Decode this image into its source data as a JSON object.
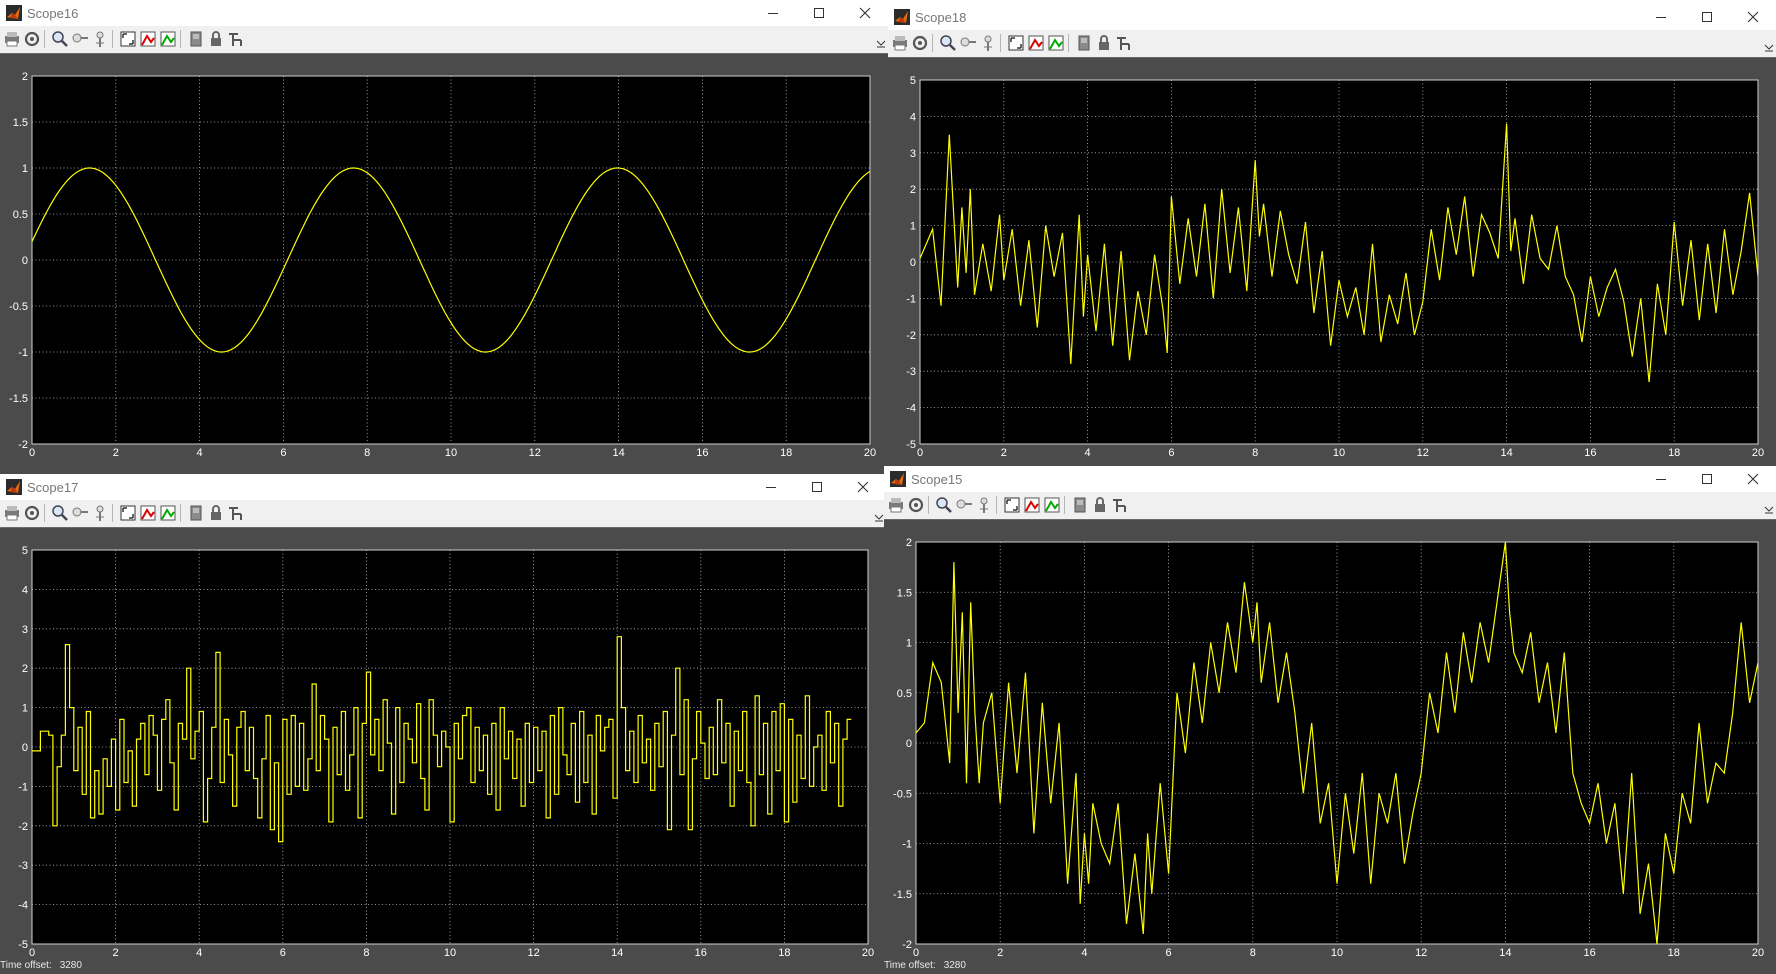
{
  "colors": {
    "background": "#000000",
    "trace": "#ffff00",
    "grid": "#bdbdbd",
    "frame": "#4b4b4b",
    "label": "#ffffff"
  },
  "toolbar_icons": [
    "print-icon",
    "parameters-icon",
    "zoom-icon",
    "zoom-x-icon",
    "zoom-y-icon",
    "autoscale-icon",
    "save-axes-settings-icon",
    "restore-axes-settings-icon",
    "floating-scope-icon",
    "lock-axes-icon",
    "signal-selection-icon"
  ],
  "scopes": [
    {
      "title": "Scope16",
      "time_offset_label": "",
      "time_offset_value": "",
      "chart_data": {
        "type": "line",
        "xlim": [
          0,
          20
        ],
        "ylim": [
          -2,
          2
        ],
        "xticks": [
          0,
          2,
          4,
          6,
          8,
          10,
          12,
          14,
          16,
          18,
          20
        ],
        "yticks": [
          -2,
          -1.5,
          -1,
          -0.5,
          0,
          0.5,
          1,
          1.5,
          2
        ],
        "grid": true,
        "series": [
          {
            "sine": {
              "amplitude": 1,
              "period": 6.3,
              "phase_at_zero": 0.2
            }
          }
        ]
      }
    },
    {
      "title": "Scope18",
      "time_offset_label": "",
      "time_offset_value": "",
      "chart_data": {
        "type": "line",
        "xlim": [
          0,
          20
        ],
        "ylim": [
          -5,
          5
        ],
        "xticks": [
          0,
          2,
          4,
          6,
          8,
          10,
          12,
          14,
          16,
          18,
          20
        ],
        "yticks": [
          -5,
          -4,
          -3,
          -2,
          -1,
          0,
          1,
          2,
          3,
          4,
          5
        ],
        "grid": true,
        "series": [
          {
            "x": [
              0,
              0.3,
              0.5,
              0.7,
              0.9,
              1.0,
              1.1,
              1.2,
              1.3,
              1.5,
              1.7,
              1.9,
              2.0,
              2.2,
              2.4,
              2.6,
              2.8,
              3.0,
              3.2,
              3.4,
              3.6,
              3.8,
              3.9,
              4.0,
              4.2,
              4.4,
              4.6,
              4.8,
              5.0,
              5.2,
              5.4,
              5.6,
              5.8,
              5.9,
              6.0,
              6.2,
              6.4,
              6.6,
              6.8,
              7.0,
              7.2,
              7.4,
              7.6,
              7.8,
              8.0,
              8.1,
              8.2,
              8.4,
              8.6,
              8.8,
              9.0,
              9.2,
              9.4,
              9.6,
              9.8,
              10.0,
              10.2,
              10.4,
              10.6,
              10.8,
              11.0,
              11.2,
              11.4,
              11.6,
              11.8,
              12.0,
              12.2,
              12.4,
              12.6,
              12.8,
              13.0,
              13.2,
              13.4,
              13.6,
              13.8,
              14.0,
              14.1,
              14.2,
              14.4,
              14.6,
              14.8,
              15.0,
              15.2,
              15.4,
              15.6,
              15.8,
              16.0,
              16.2,
              16.4,
              16.6,
              16.8,
              17.0,
              17.2,
              17.4,
              17.6,
              17.8,
              18.0,
              18.2,
              18.4,
              18.6,
              18.8,
              19.0,
              19.2,
              19.4,
              19.6,
              19.8,
              20.0
            ],
            "y": [
              0.1,
              0.9,
              -1.2,
              3.5,
              -0.7,
              1.5,
              -0.3,
              2.0,
              -0.9,
              0.5,
              -0.8,
              1.3,
              -0.5,
              0.9,
              -1.2,
              0.6,
              -1.8,
              1.0,
              -0.4,
              0.8,
              -2.8,
              1.3,
              -1.5,
              0.2,
              -1.9,
              0.5,
              -2.3,
              0.3,
              -2.7,
              -0.8,
              -2.0,
              0.2,
              -1.3,
              -2.5,
              1.8,
              -0.6,
              1.2,
              -0.4,
              1.6,
              -1.0,
              2.0,
              -0.3,
              1.5,
              -0.8,
              2.8,
              0.7,
              1.6,
              -0.4,
              1.4,
              0.2,
              -0.6,
              1.1,
              -1.4,
              0.3,
              -2.3,
              -0.5,
              -1.5,
              -0.7,
              -2.0,
              0.5,
              -2.2,
              -0.9,
              -1.7,
              -0.3,
              -2.0,
              -1.1,
              0.9,
              -0.5,
              1.5,
              0.2,
              1.8,
              -0.4,
              1.3,
              0.8,
              0.1,
              3.8,
              0.3,
              1.2,
              -0.6,
              1.3,
              0.1,
              -0.2,
              1.0,
              -0.4,
              -0.9,
              -2.2,
              -0.4,
              -1.5,
              -0.7,
              -0.2,
              -1.1,
              -2.6,
              -1.0,
              -3.3,
              -0.6,
              -2.0,
              1.1,
              -1.2,
              0.6,
              -1.6,
              0.5,
              -1.4,
              0.9,
              -0.9,
              0.3,
              1.9,
              -0.4,
              1.5
            ]
          }
        ]
      }
    },
    {
      "title": "Scope17",
      "time_offset_label": "Time offset:",
      "time_offset_value": "3280",
      "chart_data": {
        "type": "line",
        "step": true,
        "xlim": [
          0,
          20
        ],
        "ylim": [
          -5,
          5
        ],
        "xticks": [
          0,
          2,
          4,
          6,
          8,
          10,
          12,
          14,
          16,
          18,
          20
        ],
        "yticks": [
          -5,
          -4,
          -3,
          -2,
          -1,
          0,
          1,
          2,
          3,
          4,
          5
        ],
        "grid": true,
        "series": [
          {
            "x0": 0,
            "dx": 0.1,
            "y": [
              -0.1,
              -0.1,
              0.4,
              0.4,
              0.3,
              -2.0,
              -0.5,
              0.3,
              2.6,
              1.0,
              -0.6,
              0.5,
              -1.2,
              0.9,
              -1.8,
              -0.6,
              -1.7,
              -0.3,
              -1.0,
              0.2,
              -1.6,
              0.7,
              -0.9,
              -0.1,
              -1.5,
              0.2,
              0.6,
              -0.7,
              0.8,
              0.3,
              -1.1,
              0.7,
              1.2,
              -0.4,
              -1.6,
              0.6,
              0.2,
              2.0,
              -0.3,
              0.4,
              0.9,
              -1.9,
              -0.8,
              0.5,
              2.4,
              -0.9,
              0.7,
              -0.2,
              -1.5,
              0.5,
              0.9,
              -0.6,
              0.5,
              -0.8,
              -1.8,
              -0.3,
              0.8,
              -2.1,
              -0.4,
              -2.4,
              0.7,
              -1.2,
              0.8,
              -1.0,
              0.6,
              -1.1,
              -0.3,
              1.6,
              -0.6,
              0.8,
              0.2,
              -1.9,
              0.5,
              -0.7,
              0.9,
              -1.1,
              -0.2,
              1.0,
              -1.8,
              0.6,
              1.9,
              -0.2,
              0.7,
              -0.6,
              1.2,
              0.1,
              -1.7,
              1.0,
              -0.9,
              0.6,
              0.2,
              -0.4,
              1.1,
              -0.8,
              -1.6,
              1.2,
              0.3,
              -0.5,
              0.4,
              0.0,
              -1.9,
              0.6,
              -0.3,
              0.8,
              1.0,
              -0.9,
              0.5,
              -0.6,
              0.3,
              -1.2,
              0.6,
              -1.6,
              1.0,
              -0.3,
              0.4,
              -0.8,
              0.2,
              -1.5,
              0.6,
              -0.9,
              0.5,
              -0.6,
              0.4,
              -1.8,
              0.8,
              -1.2,
              1.0,
              -0.2,
              -0.7,
              0.6,
              -1.4,
              0.9,
              -0.9,
              0.3,
              -1.7,
              0.8,
              -0.1,
              0.5,
              0.7,
              -1.3,
              2.8,
              1.0,
              -0.6,
              0.4,
              -0.9,
              0.8,
              -0.4,
              0.2,
              -1.1,
              0.6,
              -0.5,
              0.9,
              -2.1,
              0.3,
              2.0,
              -0.7,
              1.2,
              -2.1,
              -0.3,
              0.9,
              0.1,
              -0.8,
              0.5,
              -0.7,
              1.2,
              -0.4,
              0.6,
              -1.5,
              0.4,
              -0.6,
              0.9,
              -0.9,
              -2.0,
              1.3,
              -0.7,
              0.6,
              -1.7,
              0.9,
              -0.6,
              1.1,
              -1.9,
              0.7,
              -1.4,
              0.3,
              -0.8,
              1.3,
              -1.0,
              0.0,
              0.3,
              -1.1,
              0.9,
              -0.4,
              0.6,
              -1.5,
              0.2,
              0.7
            ]
          }
        ]
      }
    },
    {
      "title": "Scope15",
      "time_offset_label": "Time offset:",
      "time_offset_value": "3280",
      "chart_data": {
        "type": "line",
        "xlim": [
          0,
          20
        ],
        "ylim": [
          -2,
          2
        ],
        "xticks": [
          0,
          2,
          4,
          6,
          8,
          10,
          12,
          14,
          16,
          18,
          20
        ],
        "yticks": [
          -2,
          -1.5,
          -1,
          -0.5,
          0,
          0.5,
          1,
          1.5,
          2
        ],
        "grid": true,
        "series": [
          {
            "x": [
              0,
              0.2,
              0.4,
              0.6,
              0.8,
              0.9,
              1.0,
              1.1,
              1.2,
              1.3,
              1.4,
              1.5,
              1.6,
              1.8,
              2.0,
              2.2,
              2.4,
              2.6,
              2.8,
              3.0,
              3.2,
              3.4,
              3.6,
              3.8,
              3.9,
              4.0,
              4.1,
              4.2,
              4.4,
              4.6,
              4.8,
              5.0,
              5.2,
              5.4,
              5.5,
              5.6,
              5.8,
              6.0,
              6.2,
              6.4,
              6.6,
              6.8,
              7.0,
              7.2,
              7.4,
              7.6,
              7.8,
              8.0,
              8.1,
              8.2,
              8.4,
              8.6,
              8.8,
              9.0,
              9.2,
              9.4,
              9.6,
              9.8,
              10.0,
              10.2,
              10.4,
              10.6,
              10.8,
              11.0,
              11.2,
              11.4,
              11.6,
              11.8,
              12.0,
              12.2,
              12.4,
              12.6,
              12.8,
              13.0,
              13.2,
              13.4,
              13.6,
              13.8,
              14.0,
              14.1,
              14.2,
              14.4,
              14.6,
              14.8,
              15.0,
              15.2,
              15.4,
              15.6,
              15.8,
              16.0,
              16.2,
              16.4,
              16.6,
              16.8,
              17.0,
              17.2,
              17.4,
              17.6,
              17.8,
              18.0,
              18.2,
              18.4,
              18.6,
              18.8,
              19.0,
              19.2,
              19.4,
              19.6,
              19.8,
              20.0
            ],
            "y": [
              0.1,
              0.2,
              0.8,
              0.6,
              -0.2,
              1.8,
              0.3,
              1.3,
              -0.4,
              1.4,
              0.3,
              -0.4,
              0.2,
              0.5,
              -0.6,
              0.6,
              -0.3,
              0.7,
              -0.9,
              0.4,
              -0.6,
              0.2,
              -1.4,
              -0.3,
              -1.6,
              -0.9,
              -1.4,
              -0.6,
              -1.0,
              -1.2,
              -0.6,
              -1.8,
              -1.1,
              -1.9,
              -0.9,
              -1.5,
              -0.4,
              -1.3,
              0.5,
              -0.1,
              0.8,
              0.2,
              1.0,
              0.5,
              1.2,
              0.7,
              1.6,
              1.0,
              1.4,
              0.6,
              1.2,
              0.4,
              0.9,
              0.3,
              -0.5,
              0.2,
              -0.8,
              -0.4,
              -1.4,
              -0.5,
              -1.1,
              -0.3,
              -1.4,
              -0.5,
              -0.8,
              -0.3,
              -1.2,
              -0.7,
              -0.3,
              0.5,
              0.1,
              0.9,
              0.3,
              1.1,
              0.6,
              1.2,
              0.8,
              1.4,
              2.0,
              1.3,
              0.9,
              0.7,
              1.1,
              0.4,
              0.8,
              0.1,
              0.9,
              -0.3,
              -0.6,
              -0.8,
              -0.4,
              -1.0,
              -0.6,
              -1.5,
              -0.3,
              -1.7,
              -1.2,
              -2.0,
              -0.9,
              -1.3,
              -0.5,
              -0.8,
              0.2,
              -0.6,
              -0.2,
              -0.3,
              0.3,
              1.2,
              0.4,
              0.8
            ]
          }
        ]
      }
    }
  ]
}
